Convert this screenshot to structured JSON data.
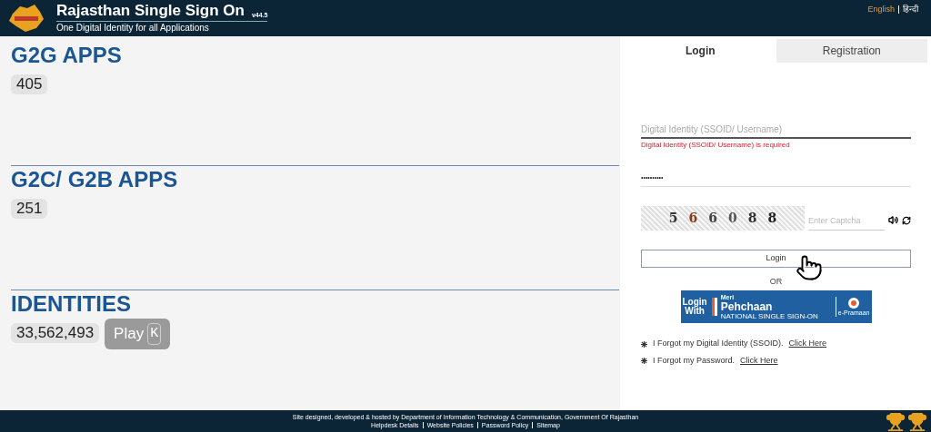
{
  "header": {
    "title": "Rajasthan Single Sign On",
    "version": "v44.5",
    "subtitle": "One Digital Identity for all Applications",
    "languages": [
      {
        "label": "English",
        "selected": true
      },
      {
        "label": "हिन्दी",
        "selected": false
      }
    ]
  },
  "stats": [
    {
      "title": "G2G APPS",
      "count": "405"
    },
    {
      "title": "G2C/ G2B APPS",
      "count": "251"
    },
    {
      "title": "IDENTITIES",
      "count": "33,562,493"
    }
  ],
  "tooltip": {
    "label": "Play",
    "key": "K"
  },
  "tabs": [
    {
      "label": "Login",
      "selected": true
    },
    {
      "label": "Registration",
      "selected": false
    }
  ],
  "login": {
    "username": {
      "placeholder": "Digital Identity (SSOID/ Username)",
      "error": "Digital Identity (SSOID/ Username) is required"
    },
    "password": {
      "value": "••••••••••"
    },
    "captcha": {
      "digits": [
        "5",
        "6",
        "6",
        "0",
        "8",
        "8"
      ],
      "placeholder": "Enter Captcha"
    },
    "button": "Login",
    "or": "OR",
    "pehchaan": {
      "login": "Login",
      "with": "With",
      "meri": "Meri",
      "name": "Pehchaan",
      "tagline": "NATIONAL SINGLE SIGN-ON",
      "epramaan": "e-Pramaan"
    },
    "links": [
      {
        "text": "I Forgot my Digital Identity (SSOID).",
        "link": "Click Here"
      },
      {
        "text": "I Forgot my Password.",
        "link": "Click Here"
      }
    ]
  },
  "footer": {
    "credit": "Site designed, developed & hosted by Department of Information Technology & Communication, Government Of Rajasthan",
    "links": [
      "Helpdesk Details",
      "Website Policies",
      "Password Policy",
      "Sitemap"
    ]
  }
}
